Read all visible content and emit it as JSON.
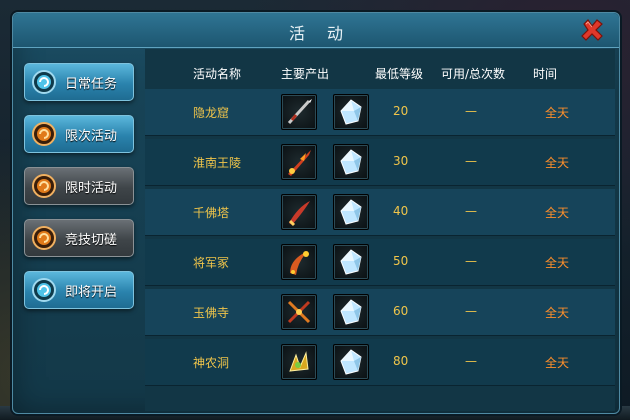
{
  "window": {
    "title": "活动"
  },
  "sidebar": {
    "items": [
      {
        "label": "日常任务",
        "style": "blue",
        "icon": "cyan-orb-icon"
      },
      {
        "label": "限次活动",
        "style": "blue",
        "icon": "orange-orb-icon"
      },
      {
        "label": "限时活动",
        "style": "gray",
        "icon": "orange-orb-icon"
      },
      {
        "label": "竞技切磋",
        "style": "gray",
        "icon": "orange-orb-icon"
      },
      {
        "label": "即将开启",
        "style": "blue",
        "icon": "cyan-orb-icon"
      }
    ]
  },
  "table": {
    "headers": {
      "name": "活动名称",
      "output": "主要产出",
      "level": "最低等级",
      "count": "可用/总次数",
      "time": "时间"
    },
    "rows": [
      {
        "name": "隐龙窟",
        "weapon_icon": "spear-icon",
        "gem_icon": "diamond-gem-icon",
        "level": "20",
        "count": "—",
        "time": "全天"
      },
      {
        "name": "淮南王陵",
        "weapon_icon": "flame-blade-icon",
        "gem_icon": "diamond-gem-icon",
        "level": "30",
        "count": "—",
        "time": "全天"
      },
      {
        "name": "千佛塔",
        "weapon_icon": "saber-icon",
        "gem_icon": "diamond-gem-icon",
        "level": "40",
        "count": "—",
        "time": "全天"
      },
      {
        "name": "将军冢",
        "weapon_icon": "curved-blade-icon",
        "gem_icon": "diamond-gem-icon",
        "level": "50",
        "count": "—",
        "time": "全天"
      },
      {
        "name": "玉佛寺",
        "weapon_icon": "cross-axe-icon",
        "gem_icon": "diamond-gem-icon",
        "level": "60",
        "count": "—",
        "time": "全天"
      },
      {
        "name": "神农洞",
        "weapon_icon": "golden-claw-icon",
        "gem_icon": "diamond-gem-icon",
        "level": "80",
        "count": "—",
        "time": "全天"
      }
    ]
  },
  "colors": {
    "name_text": "#f0c54a",
    "time_text": "#ff8f2a",
    "header_text": "#ffffff",
    "close_button": "#e0382a"
  }
}
